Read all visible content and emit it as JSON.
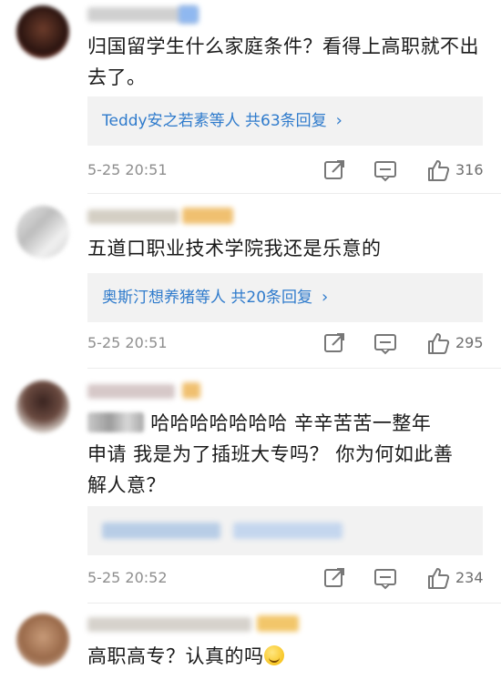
{
  "comments": [
    {
      "text": "归国留学生什么家庭条件？看得上高职就不出去了。",
      "reply_summary": "Teddy安之若素等人 共63条回复",
      "time": "5-25 20:51",
      "likes": "316",
      "icons": [
        "share-icon",
        "comment-icon",
        "like-icon"
      ]
    },
    {
      "text": "五道口职业技术学院我还是乐意的",
      "reply_summary": "奥斯汀想养猪等人 共20条回复",
      "time": "5-25 20:51",
      "likes": "295",
      "icons": [
        "share-icon",
        "comment-icon",
        "like-icon"
      ]
    },
    {
      "text_after_mosaic": "哈哈哈哈哈哈哈 辛辛苦苦一整年申请 我是为了插班大专吗？ 你为何如此善解人意？",
      "line1": "哈哈哈哈哈哈哈 辛辛苦苦一整年",
      "line2": "申请 我是为了插班大专吗？ 你为何如此善",
      "line3": "解人意？",
      "time": "5-25 20:52",
      "likes": "234",
      "icons": [
        "share-icon",
        "comment-icon",
        "like-icon"
      ]
    },
    {
      "text": "高职高专？认真的吗",
      "emoji": "laughing-crying-emoji"
    }
  ],
  "colors": {
    "link": "#2f7bcc",
    "meta": "#8e8e8e",
    "reply_bg": "#f2f2f2"
  }
}
